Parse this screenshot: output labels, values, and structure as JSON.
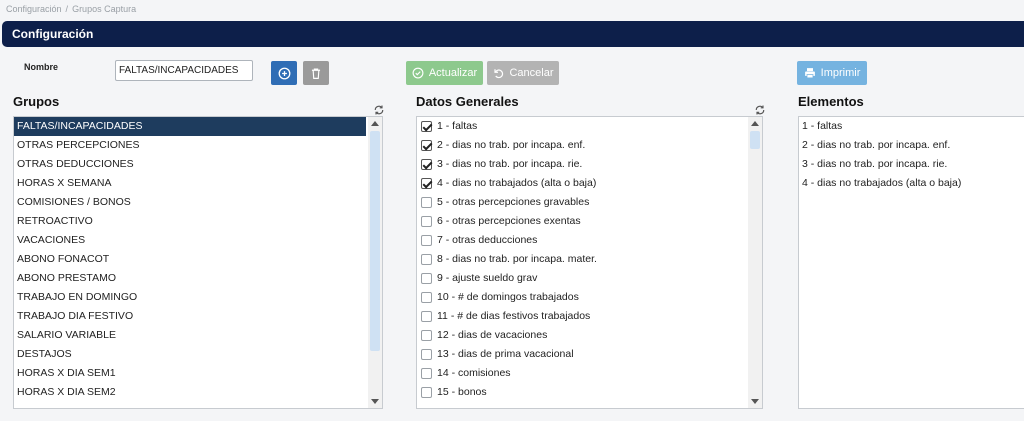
{
  "breadcrumb": {
    "item1": "Configuración",
    "item2": "Grupos Captura",
    "sep": "/"
  },
  "header": {
    "title": "Configuración"
  },
  "form": {
    "nombre_label": "Nombre",
    "nombre_value": "FALTAS/INCAPACIDADES"
  },
  "buttons": {
    "actualizar": "Actualizar",
    "cancelar": "Cancelar",
    "imprimir": "Imprimir"
  },
  "grupos": {
    "title": "Grupos",
    "items": [
      "FALTAS/INCAPACIDADES",
      "OTRAS PERCEPCIONES",
      "OTRAS DEDUCCIONES",
      "HORAS X SEMANA",
      "COMISIONES / BONOS",
      "RETROACTIVO",
      "VACACIONES",
      "ABONO FONACOT",
      "ABONO PRESTAMO",
      "TRABAJO EN DOMINGO",
      "TRABAJO DIA FESTIVO",
      "SALARIO VARIABLE",
      "DESTAJOS",
      "HORAS X DIA SEM1",
      "HORAS X DIA SEM2"
    ],
    "selected_index": 0
  },
  "datos": {
    "title": "Datos Generales",
    "items": [
      {
        "label": "1 - faltas",
        "checked": true
      },
      {
        "label": "2 - dias no trab. por incapa. enf.",
        "checked": true
      },
      {
        "label": "3 - dias no trab. por incapa. rie.",
        "checked": true
      },
      {
        "label": "4 - dias no trabajados (alta o baja)",
        "checked": true
      },
      {
        "label": "5 - otras percepciones gravables",
        "checked": false
      },
      {
        "label": "6 - otras percepciones exentas",
        "checked": false
      },
      {
        "label": "7 - otras deducciones",
        "checked": false
      },
      {
        "label": "8 - dias no trab. por incapa. mater.",
        "checked": false
      },
      {
        "label": "9 - ajuste sueldo grav",
        "checked": false
      },
      {
        "label": "10 - # de domingos trabajados",
        "checked": false
      },
      {
        "label": "11 - # de dias festivos trabajados",
        "checked": false
      },
      {
        "label": "12 - dias de vacaciones",
        "checked": false
      },
      {
        "label": "13 - dias de prima vacacional",
        "checked": false
      },
      {
        "label": "14 - comisiones",
        "checked": false
      },
      {
        "label": "15 - bonos",
        "checked": false
      }
    ]
  },
  "elementos": {
    "title": "Elementos",
    "items": [
      "1 - faltas",
      "2 - dias no trab. por incapa. enf.",
      "3 - dias no trab. por incapa. rie.",
      "4 - dias no trabajados (alta o baja)"
    ]
  },
  "colors": {
    "header_bg": "#0d1f4a",
    "selected_row": "#1e3c5e",
    "add_button": "#2f6db5",
    "actualizar_button": "#8dc98d",
    "imprimir_button": "#75b3e0"
  }
}
